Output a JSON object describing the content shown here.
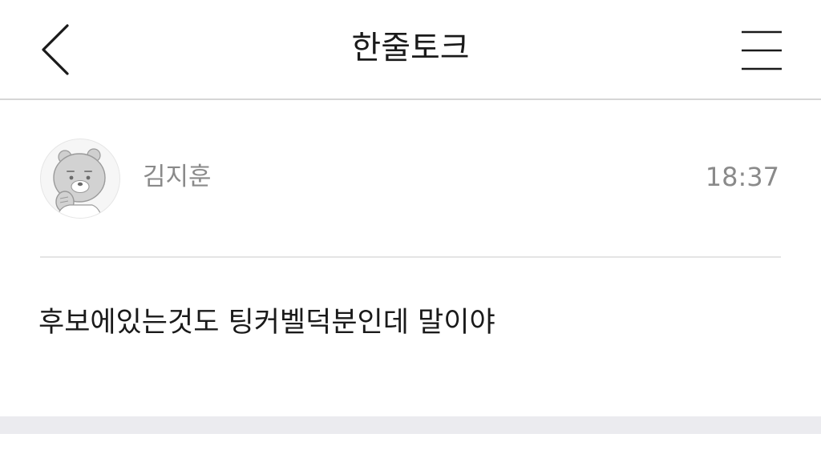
{
  "header": {
    "title": "한줄토크",
    "back_icon": "chevron-left-icon",
    "menu_icon": "hamburger-menu-icon"
  },
  "post": {
    "author": {
      "name": "김지훈",
      "avatar_icon": "bear-character-avatar"
    },
    "time": "18:37",
    "body": "후보에있는것도 팅커벨덕분인데 말이야"
  },
  "colors": {
    "title_text": "#1a1a1a",
    "meta_text": "#8a8a8a",
    "divider": "#e4e4e4",
    "footer_band": "#ebebef"
  }
}
